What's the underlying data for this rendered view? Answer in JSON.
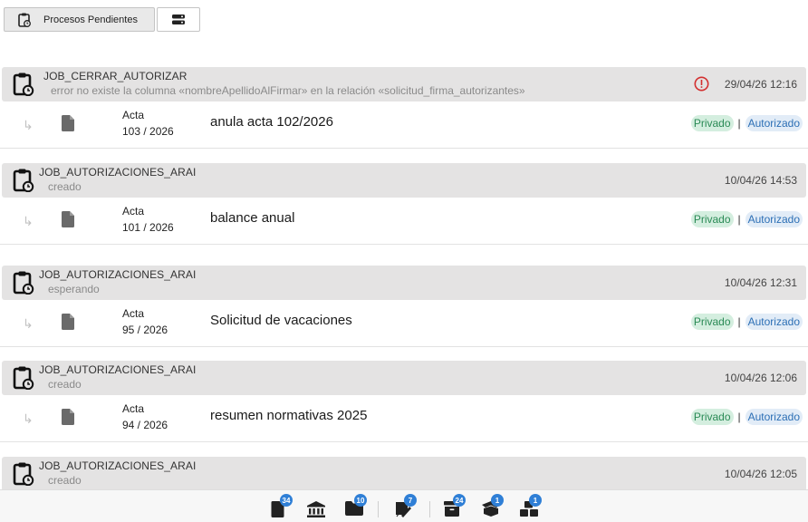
{
  "toolbar": {
    "procesos_label": "Procesos Pendientes",
    "toggle_icon": "server-toggle-icon"
  },
  "groups": [
    {
      "job": {
        "name": "JOB_CERRAR_AUTORIZAR",
        "status": "error no existe la columna «nombreApellidoAlFirmar» en la relación «solicitud_firma_autorizantes»",
        "time": "29/04/26 12:16",
        "error": true
      },
      "doc": {
        "type": "Acta",
        "number": "103 / 2026",
        "title": "anula acta 102/2026",
        "tag1": "Privado",
        "sep": "|",
        "tag2": "Autorizado"
      }
    },
    {
      "job": {
        "name": "JOB_AUTORIZACIONES_ARAI",
        "status": "creado",
        "time": "10/04/26 14:53",
        "error": false
      },
      "doc": {
        "type": "Acta",
        "number": "101 / 2026",
        "title": "balance anual",
        "tag1": "Privado",
        "sep": "|",
        "tag2": "Autorizado"
      }
    },
    {
      "job": {
        "name": "JOB_AUTORIZACIONES_ARAI",
        "status": "esperando",
        "time": "10/04/26 12:31",
        "error": false
      },
      "doc": {
        "type": "Acta",
        "number": "95 / 2026",
        "title": "Solicitud de vacaciones",
        "tag1": "Privado",
        "sep": "|",
        "tag2": "Autorizado"
      }
    },
    {
      "job": {
        "name": "JOB_AUTORIZACIONES_ARAI",
        "status": "creado",
        "time": "10/04/26 12:06",
        "error": false
      },
      "doc": {
        "type": "Acta",
        "number": "94 / 2026",
        "title": "resumen normativas 2025",
        "tag1": "Privado",
        "sep": "|",
        "tag2": "Autorizado"
      }
    },
    {
      "job": {
        "name": "JOB_AUTORIZACIONES_ARAI",
        "status": "creado",
        "time": "10/04/26 12:05",
        "error": false
      }
    }
  ],
  "bottom_bar": [
    {
      "icon": "document-icon",
      "badge": "34"
    },
    {
      "icon": "bank-icon",
      "badge": ""
    },
    {
      "icon": "folder-icon",
      "badge": "10"
    },
    {
      "icon": "signature-icon",
      "badge": "7"
    },
    {
      "icon": "archive-icon",
      "badge": "24"
    },
    {
      "icon": "open-box-icon",
      "badge": "1"
    },
    {
      "icon": "boxes-icon",
      "badge": "1"
    }
  ],
  "colors": {
    "job_bg": "#e4e3e3",
    "privado_bg": "#d4eedf",
    "privado_text": "#2a8a55",
    "autorizado_bg": "#e2ecf7",
    "autorizado_text": "#2c6fb5",
    "error_red": "#d32f2f",
    "badge_blue": "#2f7fd6"
  }
}
